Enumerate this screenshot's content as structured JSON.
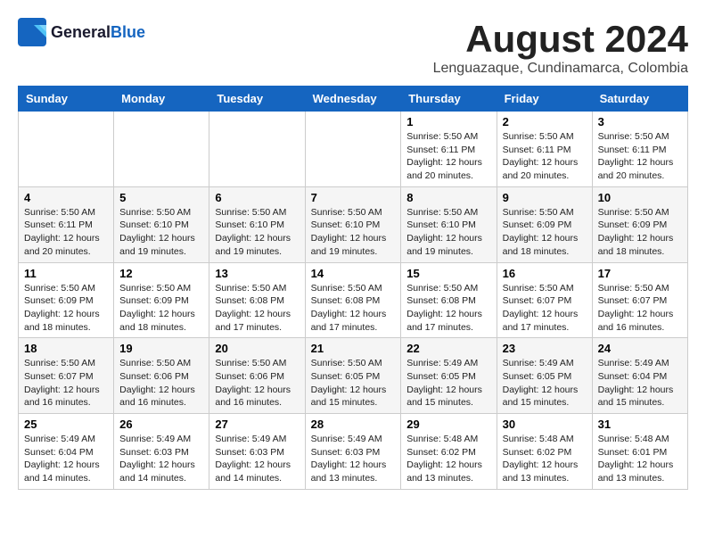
{
  "header": {
    "logo_line1": "General",
    "logo_line2": "Blue",
    "month_title": "August 2024",
    "subtitle": "Lenguazaque, Cundinamarca, Colombia"
  },
  "days_of_week": [
    "Sunday",
    "Monday",
    "Tuesday",
    "Wednesday",
    "Thursday",
    "Friday",
    "Saturday"
  ],
  "weeks": [
    [
      {
        "day": "",
        "info": ""
      },
      {
        "day": "",
        "info": ""
      },
      {
        "day": "",
        "info": ""
      },
      {
        "day": "",
        "info": ""
      },
      {
        "day": "1",
        "info": "Sunrise: 5:50 AM\nSunset: 6:11 PM\nDaylight: 12 hours\nand 20 minutes."
      },
      {
        "day": "2",
        "info": "Sunrise: 5:50 AM\nSunset: 6:11 PM\nDaylight: 12 hours\nand 20 minutes."
      },
      {
        "day": "3",
        "info": "Sunrise: 5:50 AM\nSunset: 6:11 PM\nDaylight: 12 hours\nand 20 minutes."
      }
    ],
    [
      {
        "day": "4",
        "info": "Sunrise: 5:50 AM\nSunset: 6:11 PM\nDaylight: 12 hours\nand 20 minutes."
      },
      {
        "day": "5",
        "info": "Sunrise: 5:50 AM\nSunset: 6:10 PM\nDaylight: 12 hours\nand 19 minutes."
      },
      {
        "day": "6",
        "info": "Sunrise: 5:50 AM\nSunset: 6:10 PM\nDaylight: 12 hours\nand 19 minutes."
      },
      {
        "day": "7",
        "info": "Sunrise: 5:50 AM\nSunset: 6:10 PM\nDaylight: 12 hours\nand 19 minutes."
      },
      {
        "day": "8",
        "info": "Sunrise: 5:50 AM\nSunset: 6:10 PM\nDaylight: 12 hours\nand 19 minutes."
      },
      {
        "day": "9",
        "info": "Sunrise: 5:50 AM\nSunset: 6:09 PM\nDaylight: 12 hours\nand 18 minutes."
      },
      {
        "day": "10",
        "info": "Sunrise: 5:50 AM\nSunset: 6:09 PM\nDaylight: 12 hours\nand 18 minutes."
      }
    ],
    [
      {
        "day": "11",
        "info": "Sunrise: 5:50 AM\nSunset: 6:09 PM\nDaylight: 12 hours\nand 18 minutes."
      },
      {
        "day": "12",
        "info": "Sunrise: 5:50 AM\nSunset: 6:09 PM\nDaylight: 12 hours\nand 18 minutes."
      },
      {
        "day": "13",
        "info": "Sunrise: 5:50 AM\nSunset: 6:08 PM\nDaylight: 12 hours\nand 17 minutes."
      },
      {
        "day": "14",
        "info": "Sunrise: 5:50 AM\nSunset: 6:08 PM\nDaylight: 12 hours\nand 17 minutes."
      },
      {
        "day": "15",
        "info": "Sunrise: 5:50 AM\nSunset: 6:08 PM\nDaylight: 12 hours\nand 17 minutes."
      },
      {
        "day": "16",
        "info": "Sunrise: 5:50 AM\nSunset: 6:07 PM\nDaylight: 12 hours\nand 17 minutes."
      },
      {
        "day": "17",
        "info": "Sunrise: 5:50 AM\nSunset: 6:07 PM\nDaylight: 12 hours\nand 16 minutes."
      }
    ],
    [
      {
        "day": "18",
        "info": "Sunrise: 5:50 AM\nSunset: 6:07 PM\nDaylight: 12 hours\nand 16 minutes."
      },
      {
        "day": "19",
        "info": "Sunrise: 5:50 AM\nSunset: 6:06 PM\nDaylight: 12 hours\nand 16 minutes."
      },
      {
        "day": "20",
        "info": "Sunrise: 5:50 AM\nSunset: 6:06 PM\nDaylight: 12 hours\nand 16 minutes."
      },
      {
        "day": "21",
        "info": "Sunrise: 5:50 AM\nSunset: 6:05 PM\nDaylight: 12 hours\nand 15 minutes."
      },
      {
        "day": "22",
        "info": "Sunrise: 5:49 AM\nSunset: 6:05 PM\nDaylight: 12 hours\nand 15 minutes."
      },
      {
        "day": "23",
        "info": "Sunrise: 5:49 AM\nSunset: 6:05 PM\nDaylight: 12 hours\nand 15 minutes."
      },
      {
        "day": "24",
        "info": "Sunrise: 5:49 AM\nSunset: 6:04 PM\nDaylight: 12 hours\nand 15 minutes."
      }
    ],
    [
      {
        "day": "25",
        "info": "Sunrise: 5:49 AM\nSunset: 6:04 PM\nDaylight: 12 hours\nand 14 minutes."
      },
      {
        "day": "26",
        "info": "Sunrise: 5:49 AM\nSunset: 6:03 PM\nDaylight: 12 hours\nand 14 minutes."
      },
      {
        "day": "27",
        "info": "Sunrise: 5:49 AM\nSunset: 6:03 PM\nDaylight: 12 hours\nand 14 minutes."
      },
      {
        "day": "28",
        "info": "Sunrise: 5:49 AM\nSunset: 6:03 PM\nDaylight: 12 hours\nand 13 minutes."
      },
      {
        "day": "29",
        "info": "Sunrise: 5:48 AM\nSunset: 6:02 PM\nDaylight: 12 hours\nand 13 minutes."
      },
      {
        "day": "30",
        "info": "Sunrise: 5:48 AM\nSunset: 6:02 PM\nDaylight: 12 hours\nand 13 minutes."
      },
      {
        "day": "31",
        "info": "Sunrise: 5:48 AM\nSunset: 6:01 PM\nDaylight: 12 hours\nand 13 minutes."
      }
    ]
  ]
}
